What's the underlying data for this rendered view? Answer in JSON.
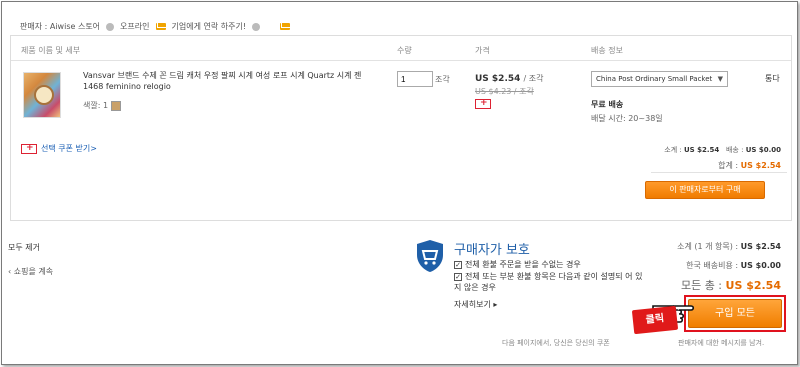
{
  "seller": {
    "label": "판매자 : Aiwise 스토어",
    "offline": "오프라인",
    "contact": "기업에게 연락 하주기!"
  },
  "table": {
    "headers": [
      "제품 이름 및 세부",
      "수량",
      "가격",
      "배송 정보"
    ],
    "product": {
      "name": "Vansvar 브랜드 수제 꼰 드림 캐처 우정 팔찌 시계 여성 로프 시계 Quartz 시계 젠 1468 feminino relogio",
      "color_label": "색깔: 1",
      "qty": "1",
      "qty_unit": "조각",
      "price": "US $2.54",
      "price_unit": "/ 조각",
      "old_price": "US $4.23 / 조각",
      "shipping_method": "China Post Ordinary Small Packet",
      "edge_text": "통다",
      "free_shipping": "무료 배송",
      "delivery_time": "배달 시간: 20~38일"
    },
    "coupon": "선택 쿠폰 받기>",
    "subtotal_label": "소계 :",
    "subtotal_value": "US $2.54",
    "shipping_label": "배송 :",
    "shipping_value": "US $0.00",
    "total_label": "합계 :",
    "total_value": "US $2.54",
    "buy_from_seller": "이 판매자로부터 구매"
  },
  "footer": {
    "remove_all": "모두 제거",
    "continue_shopping": "쇼핑을 계속",
    "protection_title": "구매자가 보호",
    "protection_items": [
      "전체 환불 주문을 받을 수없는 경우",
      "전체 또는 부분 환불 항목은 다음과 같이 설명되 어 있지 않은 경우"
    ],
    "learn_more": "자세히보기 ▸",
    "summary_subtotal_label": "소계 (1 개 항목) :",
    "summary_subtotal_value": "US $2.54",
    "summary_shipping_label": "한국 배송비용 :",
    "summary_shipping_value": "US $0.00",
    "summary_total_label": "모든 총 :",
    "summary_total_value": "US $2.54",
    "buy_all": "구입 모든",
    "click_badge": "클릭",
    "next_page_note": "다음 페이지에서, 당신은 당신의 쿠폰",
    "next_page_note2": "판매자에 대한 메시지를 남겨."
  }
}
